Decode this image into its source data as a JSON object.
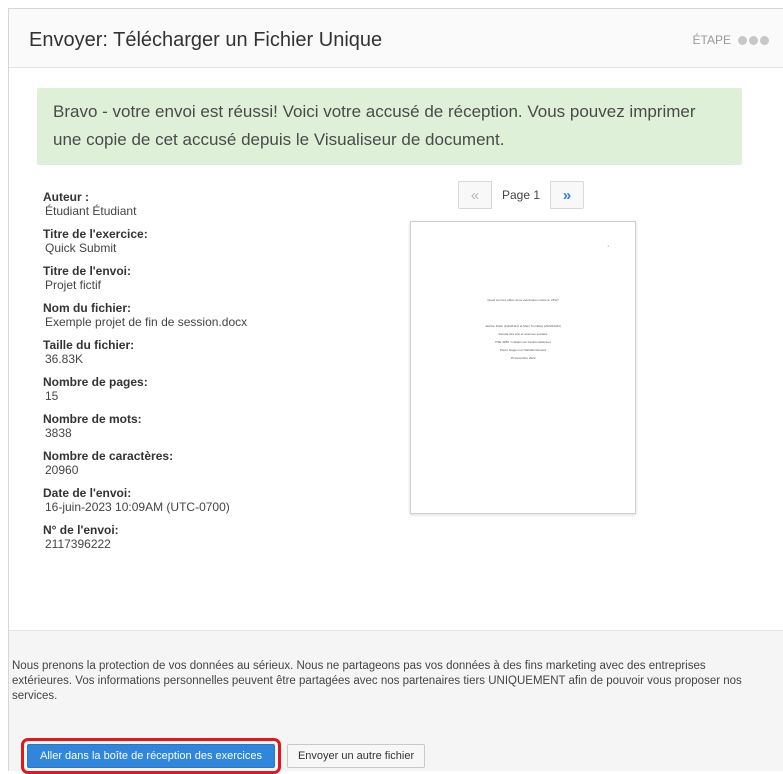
{
  "header": {
    "title": "Envoyer: Télécharger un Fichier Unique",
    "step_label": "ÉTAPE"
  },
  "success_message": "Bravo - votre envoi est réussi! Voici votre accusé de réception. Vous pouvez imprimer une copie de cet accusé depuis le Visualiseur de document.",
  "receipt": [
    {
      "label": "Auteur :",
      "value": "Étudiant Étudiant"
    },
    {
      "label": "Titre de l'exercice:",
      "value": "Quick Submit"
    },
    {
      "label": "Titre de l'envoi:",
      "value": "Projet fictif"
    },
    {
      "label": "Nom du fichier:",
      "value": "Exemple projet de fin de session.docx"
    },
    {
      "label": "Taille du fichier:",
      "value": "36.83K"
    },
    {
      "label": "Nombre de pages:",
      "value": "15"
    },
    {
      "label": "Nombre de mots:",
      "value": "3838"
    },
    {
      "label": "Nombre de caractères:",
      "value": "20960"
    },
    {
      "label": "Date de l'envoi:",
      "value": "16-juin-2023 10:09AM (UTC-0700)"
    },
    {
      "label": "N° de l'envoi:",
      "value": "2117396222"
    }
  ],
  "pager": {
    "prev": "«",
    "label": "Page 1",
    "next": "»"
  },
  "preview": {
    "page_number": "1",
    "title": "Quels sont les effets de la vaccination contre le VPH?",
    "lines": [
      "Jeanne Dubé (111111111) et Marc Tremblay (222222222)",
      "Faculté des arts et sciences sociales",
      "PSE 4280 : Initiation au travail intellectuel",
      "Pierre Gagnon et Nathalie Renaud",
      "15 décembre 2022"
    ]
  },
  "footer": {
    "privacy_text": "Nous prenons la protection de vos données au sérieux. Nous ne partageons pas vos données à des fins marketing avec des entreprises extérieures. Vos informations personnelles peuvent être partagées avec nos partenaires tiers UNIQUEMENT afin de pouvoir vous proposer nos services.",
    "primary_button": "Aller dans la boîte de réception des exercices",
    "secondary_button": "Envoyer un autre fichier"
  },
  "colors": {
    "success_bg": "#dff0d8",
    "primary": "#2f86dc",
    "highlight": "#e3161b"
  }
}
